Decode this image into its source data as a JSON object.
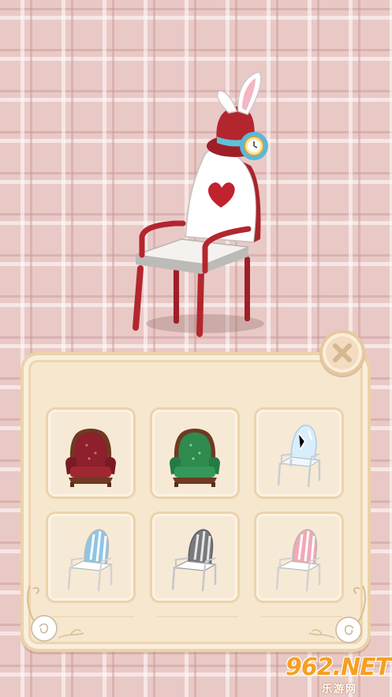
{
  "preview": {
    "item": "white-rabbit-chair"
  },
  "panel": {
    "close_icon": "close-icon",
    "slots": [
      {
        "icon": "red-velvet-armchair-icon",
        "color": "#8e1f2c"
      },
      {
        "icon": "green-velvet-armchair-icon",
        "color": "#2f8a4e"
      },
      {
        "icon": "crystal-chair-icon",
        "color": "#bfe0f6"
      },
      {
        "icon": "blue-striped-chair-icon",
        "color": "#8ec5e6"
      },
      {
        "icon": "gray-striped-chair-icon",
        "color": "#7a7a7e"
      },
      {
        "icon": "pink-striped-chair-icon",
        "color": "#f1a9b6"
      }
    ]
  },
  "watermark": {
    "main": "962.NET",
    "sub": "乐游网"
  },
  "colors": {
    "panel_bg": "#f6e7cf",
    "panel_border": "#ecd2a8",
    "chair_red": "#a8252c"
  }
}
